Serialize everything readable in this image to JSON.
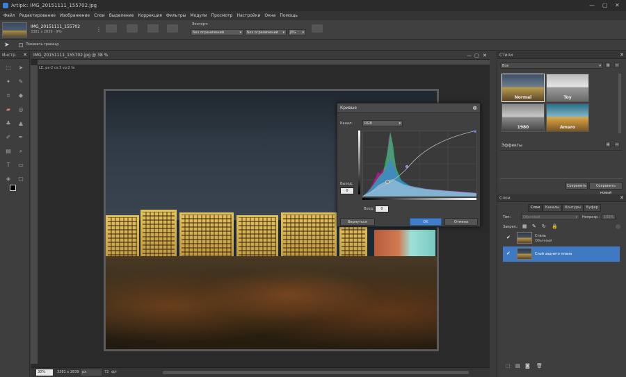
{
  "window": {
    "title": "Artipic: IMG_20151111_155702.jpg",
    "controls": [
      "—",
      "▢",
      "✕"
    ]
  },
  "menu": [
    "Файл",
    "Редактирование",
    "Изображение",
    "Слои",
    "Выделение",
    "Коррекция",
    "Фильтры",
    "Модули",
    "Просмотр",
    "Настройки",
    "Окна",
    "Помощь"
  ],
  "file": {
    "name": "IMG_20151111_155702",
    "meta": "3381 x 2839 · JPG",
    "export_label": "Экспорт:",
    "export_w": "Без ограничений",
    "export_h": "Без ограничений",
    "format": "JPG"
  },
  "options": {
    "show_border": "Показать границу"
  },
  "tools_panel": {
    "title": "Инстр."
  },
  "document": {
    "tab": "IMG_20151111_155702.jpg @ 38 %",
    "info": "LE: px-2 cs:3 vp:2 fa",
    "zoom": "30%",
    "size": "3381 x 2839",
    "unit": "px",
    "dpi": "72",
    "dpi_unit": "ф/г"
  },
  "curves": {
    "title": "Кривые",
    "channel_label": "Канал:",
    "channel": "RGB",
    "output_label": "Выход:",
    "output_value": "0",
    "input_label": "Вход:",
    "input_value": "0",
    "reset": "Вернуться",
    "ok": "OK",
    "cancel": "Отмена"
  },
  "styles_panel": {
    "title": "Стили",
    "filter": "Все",
    "items": [
      "Normal",
      "Toy",
      "1980",
      "Amaro"
    ],
    "effects_title": "Эффекты",
    "save": "Сохранить",
    "save_new": "Сохранить новый"
  },
  "layers_panel": {
    "title": "Слои",
    "tabs": [
      "Слои",
      "Каналы",
      "Контуры",
      "Буфер"
    ],
    "type_label": "Тип:",
    "blend": "Обычный",
    "opacity_label": "Непрозр.:",
    "opacity": "100%",
    "lock_label": "Закреп.:",
    "layers": [
      {
        "name": "Стиль",
        "sub": "Обычный"
      },
      {
        "name": "Слой заднего плана",
        "sub": ""
      }
    ]
  },
  "colors": {
    "accent": "#3f7cc9",
    "bg": "#3b3b3b"
  }
}
